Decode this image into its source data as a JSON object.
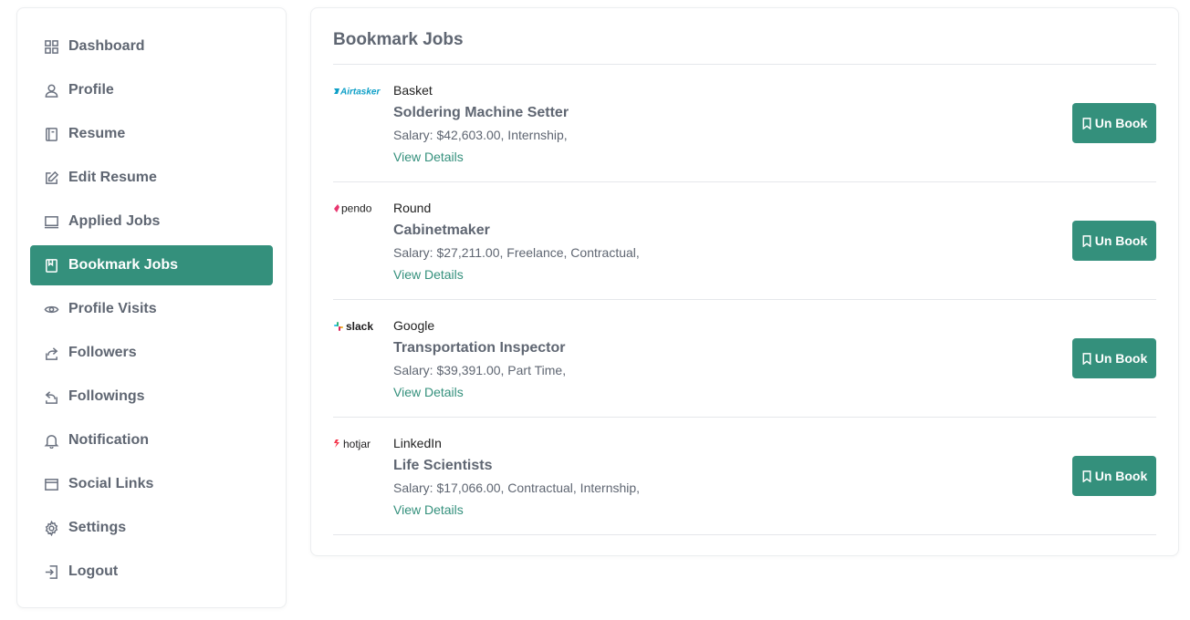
{
  "sidebar": {
    "items": [
      {
        "label": "Dashboard",
        "icon": "grid-icon",
        "active": false
      },
      {
        "label": "Profile",
        "icon": "user-icon",
        "active": false
      },
      {
        "label": "Resume",
        "icon": "document-icon",
        "active": false
      },
      {
        "label": "Edit Resume",
        "icon": "edit-icon",
        "active": false
      },
      {
        "label": "Applied Jobs",
        "icon": "laptop-icon",
        "active": false
      },
      {
        "label": "Bookmark Jobs",
        "icon": "bookmark-book-icon",
        "active": true
      },
      {
        "label": "Profile Visits",
        "icon": "eye-icon",
        "active": false
      },
      {
        "label": "Followers",
        "icon": "share-icon",
        "active": false
      },
      {
        "label": "Followings",
        "icon": "reply-icon",
        "active": false
      },
      {
        "label": "Notification",
        "icon": "bell-icon",
        "active": false
      },
      {
        "label": "Social Links",
        "icon": "browser-icon",
        "active": false
      },
      {
        "label": "Settings",
        "icon": "gear-icon",
        "active": false
      },
      {
        "label": "Logout",
        "icon": "logout-icon",
        "active": false
      }
    ]
  },
  "main": {
    "title": "Bookmark Jobs",
    "unbook_label": "Un Book",
    "details_label": "View Details",
    "jobs": [
      {
        "logo": "Airtasker",
        "logo_color": "#0d9fc7",
        "company": "Basket",
        "title": "Soldering Machine Setter",
        "salary": "Salary: $42,603.00, Internship,"
      },
      {
        "logo": "pendo",
        "logo_color": "#222222",
        "company": "Round",
        "title": "Cabinetmaker",
        "salary": "Salary: $27,211.00, Freelance, Contractual,"
      },
      {
        "logo": "slack",
        "logo_color": "#1d1c1d",
        "company": "Google",
        "title": "Transportation Inspector",
        "salary": "Salary: $39,391.00, Part Time,"
      },
      {
        "logo": "hotjar",
        "logo_color": "#1d1c1d",
        "company": "LinkedIn",
        "title": "Life Scientists",
        "salary": "Salary: $17,066.00, Contractual, Internship,"
      }
    ]
  },
  "colors": {
    "accent": "#34907c",
    "text": "#5f6672"
  }
}
